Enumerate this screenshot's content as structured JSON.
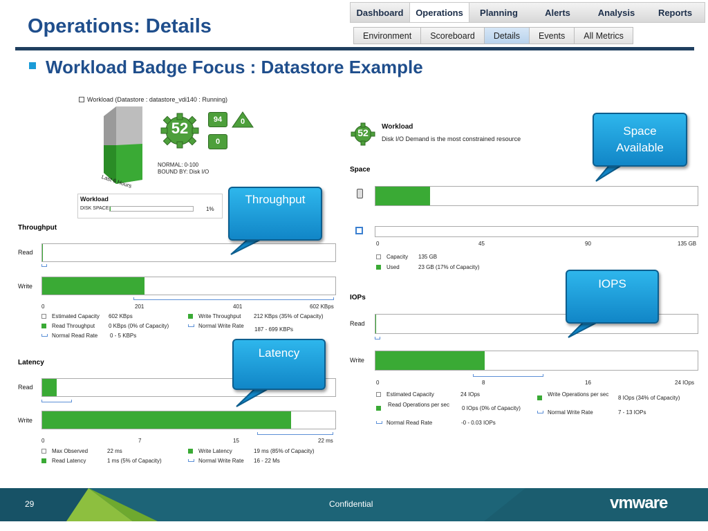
{
  "slide": {
    "title": "Operations: Details",
    "bullet": "Workload Badge Focus : Datastore Example",
    "page_number": "29",
    "footer_text": "Confidential",
    "logo_text": "vmware"
  },
  "nav": {
    "top_tabs": [
      "Dashboard",
      "Operations",
      "Planning",
      "Alerts",
      "Analysis",
      "Reports"
    ],
    "top_active": "Operations",
    "sub_tabs": [
      "Environment",
      "Scoreboard",
      "Details",
      "Events",
      "All Metrics"
    ],
    "sub_active": "Details"
  },
  "badge_panel": {
    "header": "Workload (Datastore : datastore_vdi140 : Running)",
    "score": "52",
    "sub_badges": [
      "94",
      "0",
      "0"
    ],
    "normal_label": "NORMAL: 0-100",
    "bound_label": "BOUND BY: Disk I/O",
    "history_label": "Last 6 Hours",
    "workload_box_title": "Workload",
    "disk_space_label": "DISK SPACE",
    "disk_space_value": "1%",
    "disk_space_fraction": 0.01
  },
  "throughput": {
    "title": "Throughput",
    "rows": [
      {
        "label": "Read",
        "fraction": 0.0
      },
      {
        "label": "Write",
        "fraction": 0.35
      }
    ],
    "ticks": [
      "0",
      "201",
      "401",
      "602 KBps"
    ],
    "legend": [
      {
        "key": "Estimated Capacity",
        "value": "602 KBps",
        "type": "empty"
      },
      {
        "key": "Read Throughput",
        "value": "0 KBps (0% of Capacity)",
        "type": "green"
      },
      {
        "key": "Normal Read Rate",
        "value": "0 - 5 KBPs",
        "type": "range"
      },
      {
        "key": "Write Throughput",
        "value": "212 KBps (35% of Capacity)",
        "type": "green"
      },
      {
        "key": "Normal Write Rate",
        "value": "187 - 699 KBPs",
        "type": "range"
      }
    ]
  },
  "latency": {
    "title": "Latency",
    "rows": [
      {
        "label": "Read",
        "fraction": 0.05
      },
      {
        "label": "Write",
        "fraction": 0.85
      }
    ],
    "ticks": [
      "0",
      "7",
      "15",
      "22 ms"
    ],
    "legend": [
      {
        "key": "Max Observed",
        "value": "22 ms",
        "type": "empty"
      },
      {
        "key": "Read Latency",
        "value": "1 ms (5% of Capacity)",
        "type": "green"
      },
      {
        "key": "Write Latency",
        "value": "19 ms (85% of Capacity)",
        "type": "green"
      },
      {
        "key": "Normal Write Rate",
        "value": "16 - 22 Ms",
        "type": "range"
      }
    ]
  },
  "right_panel": {
    "score": "52",
    "title": "Workload",
    "subtitle": "Disk I/O Demand is the most constrained resource",
    "space": {
      "title": "Space",
      "fraction": 0.17,
      "ticks": [
        "0",
        "45",
        "90",
        "135 GB"
      ],
      "legend": [
        {
          "key": "Capacity",
          "value": "135 GB",
          "type": "empty"
        },
        {
          "key": "Used",
          "value": "23 GB (17% of Capacity)",
          "type": "green"
        }
      ]
    },
    "iops": {
      "title": "IOPs",
      "rows": [
        {
          "label": "Read",
          "fraction": 0.0
        },
        {
          "label": "Write",
          "fraction": 0.34
        }
      ],
      "ticks": [
        "0",
        "8",
        "16",
        "24 IOps"
      ],
      "legend": [
        {
          "key": "Estimated Capacity",
          "value": "24 IOps",
          "type": "empty"
        },
        {
          "key": "Read Operations per sec",
          "value": "0 IOps (0% of Capacity)",
          "type": "green"
        },
        {
          "key": "Normal Read Rate",
          "value": "-0 - 0.03 IOPs",
          "type": "range"
        },
        {
          "key": "Write Operations per sec",
          "value": "8 IOps (34% of Capacity)",
          "type": "green"
        },
        {
          "key": "Normal Write Rate",
          "value": "7 - 13 IOPs",
          "type": "range"
        }
      ]
    }
  },
  "callouts": {
    "space": "Space\nAvailable",
    "throughput": "Throughput",
    "iops": "IOPS",
    "latency": "Latency"
  },
  "colors": {
    "accent_green": "#3aaa35",
    "title_blue": "#1f4e8c",
    "callout_blue": "#1a9bd7",
    "footer_teal": "#1d6477"
  }
}
